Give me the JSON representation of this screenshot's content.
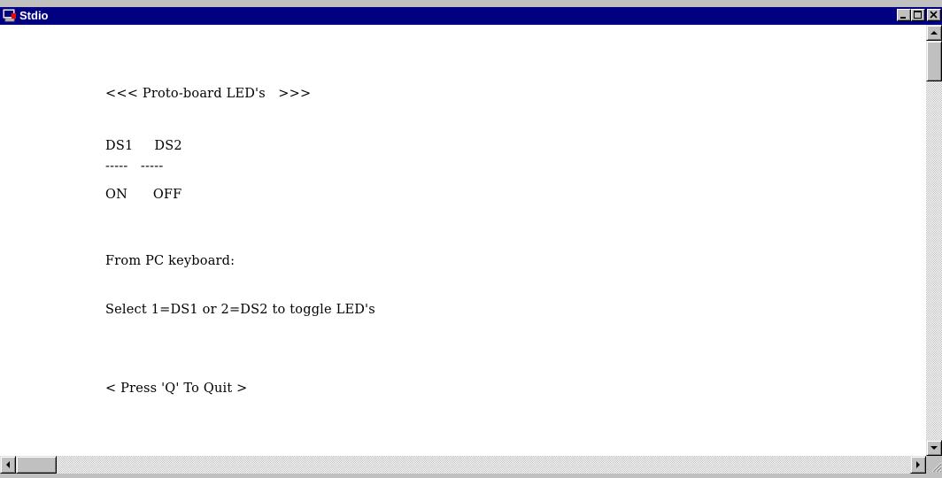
{
  "window": {
    "title": "Stdio",
    "icon": "terminal-app-icon"
  },
  "console": {
    "lines": [
      "<<< Proto-board LED's   >>>",
      "DS1     DS2",
      "-----   -----",
      "ON      OFF",
      "From PC keyboard:",
      "Select 1=DS1 or 2=DS2 to toggle LED's",
      "< Press 'Q' To Quit >"
    ]
  },
  "colors": {
    "titlebar": "#000080",
    "title_text": "#ffffff",
    "client_bg": "#ffffff",
    "chrome": "#c0c0c0"
  },
  "controls": {
    "minimize_icon": "minimize-icon",
    "maximize_icon": "maximize-icon",
    "close_icon": "close-icon",
    "scroll_up_icon": "arrow-up-icon",
    "scroll_down_icon": "arrow-down-icon",
    "scroll_left_icon": "arrow-left-icon",
    "scroll_right_icon": "arrow-right-icon",
    "resize_grip_icon": "resize-grip-icon"
  }
}
